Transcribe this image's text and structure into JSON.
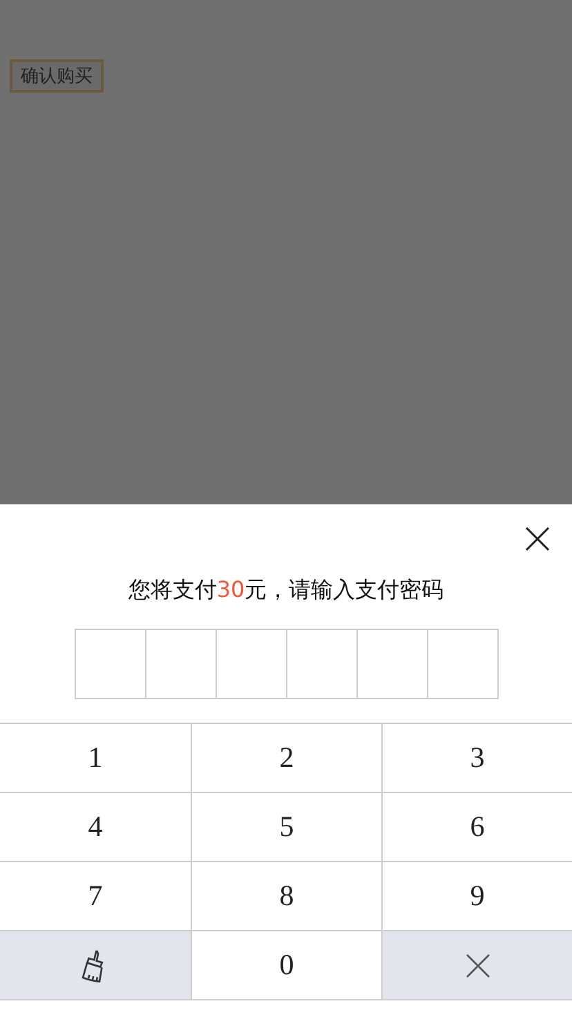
{
  "page": {
    "buy_button": "确认购买"
  },
  "pay_sheet": {
    "prompt": {
      "before": "您将支付",
      "amount": "30",
      "after": "元，请输入支付密码"
    },
    "pin_cells": [
      {
        "filled": false
      },
      {
        "filled": false
      },
      {
        "filled": false
      },
      {
        "filled": false
      },
      {
        "filled": false
      },
      {
        "filled": false
      }
    ],
    "keys": [
      {
        "kind": "digit",
        "label": "1"
      },
      {
        "kind": "digit",
        "label": "2"
      },
      {
        "kind": "digit",
        "label": "3"
      },
      {
        "kind": "digit",
        "label": "4"
      },
      {
        "kind": "digit",
        "label": "5"
      },
      {
        "kind": "digit",
        "label": "6"
      },
      {
        "kind": "digit",
        "label": "7"
      },
      {
        "kind": "digit",
        "label": "8"
      },
      {
        "kind": "digit",
        "label": "9"
      },
      {
        "kind": "clear"
      },
      {
        "kind": "digit",
        "label": "0"
      },
      {
        "kind": "delete"
      }
    ]
  }
}
